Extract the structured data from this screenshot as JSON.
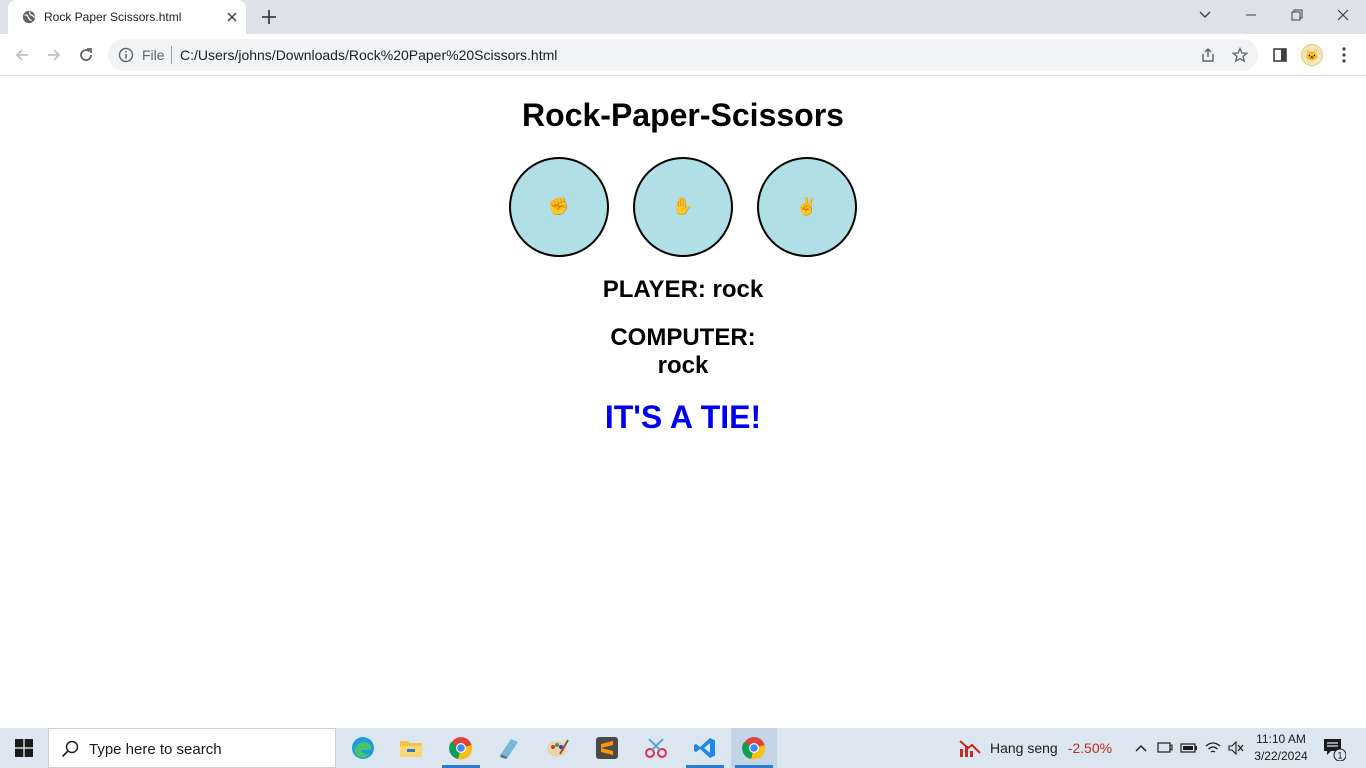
{
  "browser": {
    "tab_title": "Rock Paper Scissors.html",
    "omnibox_scheme": "File",
    "url": "C:/Users/johns/Downloads/Rock%20Paper%20Scissors.html"
  },
  "game": {
    "title": "Rock-Paper-Scissors",
    "choices": [
      {
        "name": "rock",
        "glyph": "✊"
      },
      {
        "name": "paper",
        "glyph": "✋"
      },
      {
        "name": "scissors",
        "glyph": "✌"
      }
    ],
    "player_text": "PLAYER: rock",
    "computer_label": "COMPUTER:",
    "computer_choice": "rock",
    "result_text": "IT'S A TIE!",
    "choice_bg_color": "#b0e0e6",
    "result_color": "#0000ee"
  },
  "taskbar": {
    "search_placeholder": "Type here to search",
    "stock_name": "Hang seng",
    "stock_change": "-2.50%",
    "time": "11:10 AM",
    "date": "3/22/2024",
    "notification_count": "1"
  }
}
